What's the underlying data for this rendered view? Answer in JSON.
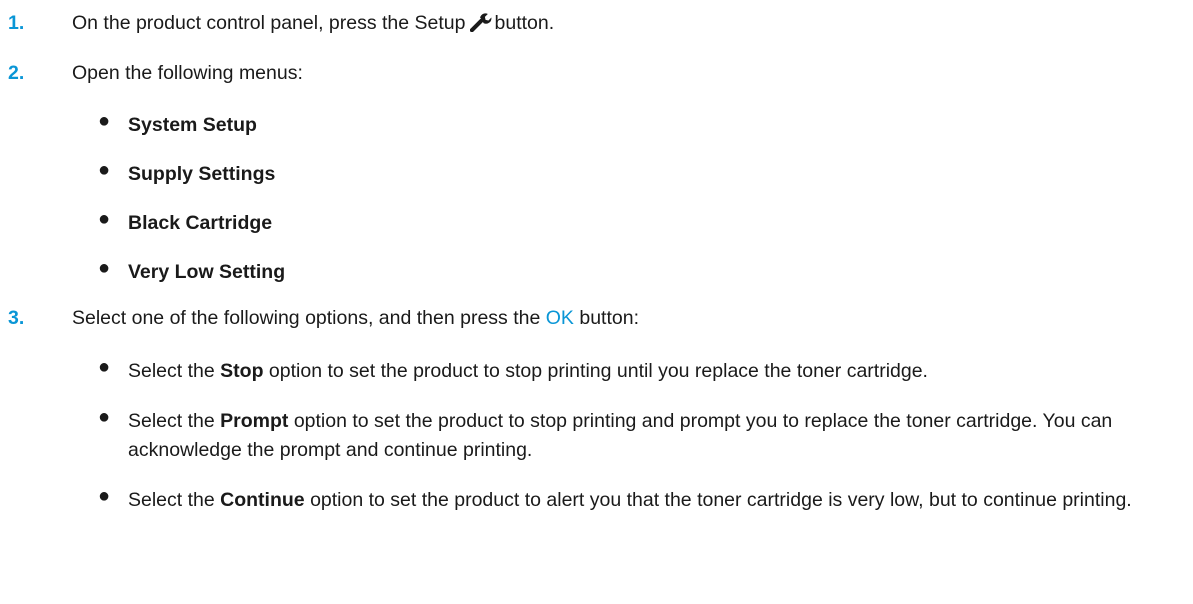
{
  "steps": [
    {
      "number": "1.",
      "text_before": "On the product control panel, press the Setup",
      "icon": "wrench-icon",
      "text_after": "button."
    },
    {
      "number": "2.",
      "text": "Open the following menus:",
      "menus": [
        "System Setup",
        "Supply Settings",
        "Black Cartridge",
        "Very Low Setting"
      ]
    },
    {
      "number": "3.",
      "text_before": "Select one of the following options, and then press the",
      "ok_label": "OK",
      "text_after": "button:",
      "options": [
        {
          "pre": "Select the",
          "option": "Stop",
          "post": "option to set the product to stop printing until you replace the toner cartridge."
        },
        {
          "pre": "Select the",
          "option": "Prompt",
          "post": "option to set the product to stop printing and prompt you to replace the toner cartridge. You can acknowledge the prompt and continue printing."
        },
        {
          "pre": "Select the",
          "option": "Continue",
          "post": "option to set the product to alert you that the toner cartridge is very low, but to continue printing."
        }
      ]
    }
  ],
  "colors": {
    "step_number": "#0a96d6",
    "ok_label": "#0a96d6",
    "text": "#1a1a1a"
  }
}
